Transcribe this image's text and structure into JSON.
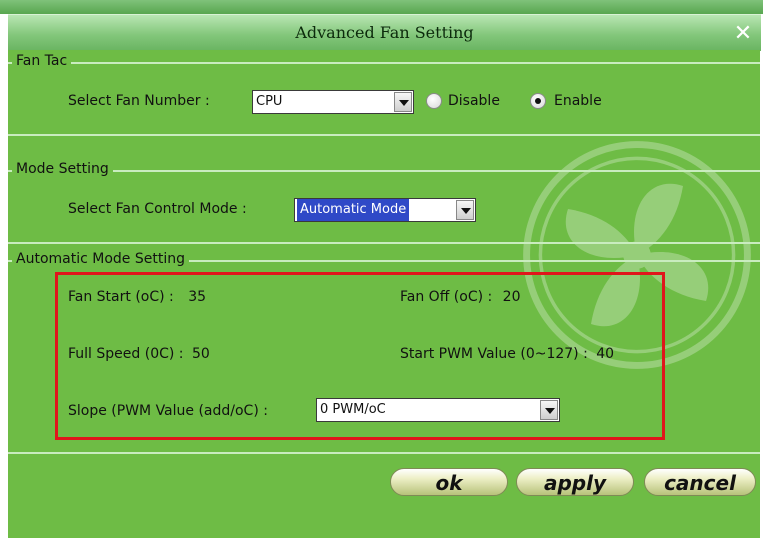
{
  "window": {
    "title": "Advanced Fan Setting",
    "close_glyph": "✕"
  },
  "fan_tac": {
    "title": "Fan Tac",
    "select_label": "Select Fan Number :",
    "fan_value": "CPU",
    "disable_label": "Disable",
    "enable_label": "Enable",
    "selected": "Enable"
  },
  "mode_setting": {
    "title": "Mode Setting",
    "select_label": "Select Fan Control Mode :",
    "mode_value": "Automatic Mode"
  },
  "auto": {
    "title": "Automatic Mode Setting",
    "fan_start_label": "Fan Start (oC) :",
    "fan_start_value": "35",
    "fan_off_label": "Fan Off (oC) :",
    "fan_off_value": "20",
    "full_speed_label": "Full Speed (0C) :",
    "full_speed_value": "50",
    "start_pwm_label": "Start PWM Value (0~127) :",
    "start_pwm_value": "40",
    "slope_label": "Slope (PWM Value (add/oC) :",
    "slope_value": "0 PWM/oC"
  },
  "buttons": {
    "ok": "ok",
    "apply": "apply",
    "cancel": "cancel"
  },
  "colors": {
    "panel": "#6ebc45",
    "highlight": "#e0161b",
    "selection": "#2f49c7"
  }
}
